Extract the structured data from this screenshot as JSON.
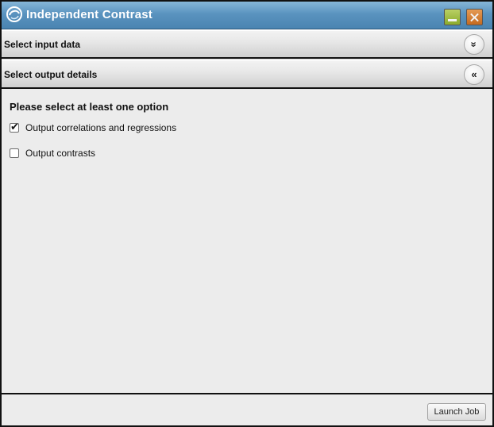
{
  "window": {
    "title": "Independent Contrast",
    "minimize_icon": "minimize-icon",
    "close_icon": "close-icon"
  },
  "sections": {
    "input": {
      "label": "Select input data",
      "toggle_glyph": "»",
      "toggle_icon": "chevron-double-down-icon"
    },
    "output": {
      "label": "Select output details",
      "toggle_glyph": "«",
      "toggle_icon": "chevron-double-left-icon"
    }
  },
  "options": {
    "heading": "Please select at least one option",
    "items": [
      {
        "label": "Output correlations and regressions",
        "checked": true
      },
      {
        "label": "Output contrasts",
        "checked": false
      }
    ]
  },
  "footer": {
    "launch_label": "Launch Job"
  },
  "colors": {
    "titlebar": "#5a93bf",
    "minimize": "#8bab2c",
    "close": "#c46a20"
  }
}
